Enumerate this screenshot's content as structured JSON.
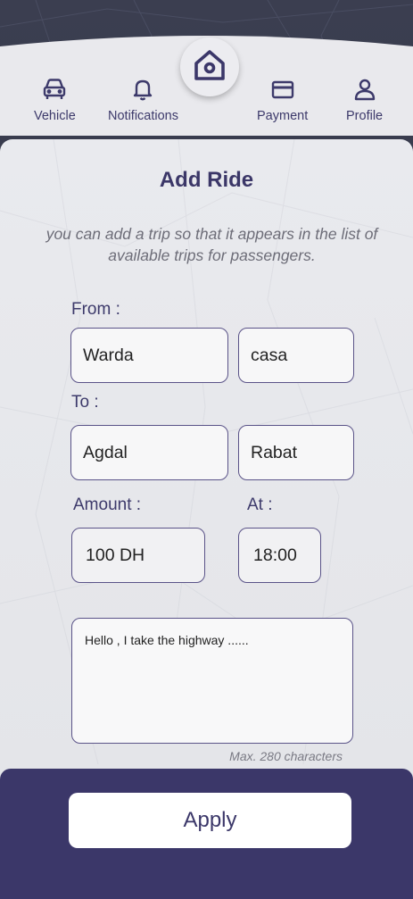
{
  "nav": {
    "items": [
      {
        "label": "Vehicle",
        "icon": "car-icon"
      },
      {
        "label": "Notifications",
        "icon": "bell-icon"
      },
      {
        "label": "Payment",
        "icon": "credit-card-icon"
      },
      {
        "label": "Profile",
        "icon": "user-icon"
      }
    ],
    "home_icon": "home-icon"
  },
  "form": {
    "title": "Add Ride",
    "subtitle": "you can add a trip so that it appears in the list of available trips for passengers.",
    "from_label": "From :",
    "from_place": "Warda",
    "from_city": "casa",
    "to_label": "To :",
    "to_place": "Agdal",
    "to_city": "Rabat",
    "amount_label": "Amount :",
    "amount_value": "100 DH",
    "at_label": "At :",
    "at_value": "18:00",
    "message": "Hello , I take the highway ......",
    "max_chars": "Max. 280 characters",
    "apply_label": "Apply"
  },
  "colors": {
    "primary": "#3b3769",
    "card_bg": "#e9eaee",
    "map_bg": "#3b3e50"
  }
}
